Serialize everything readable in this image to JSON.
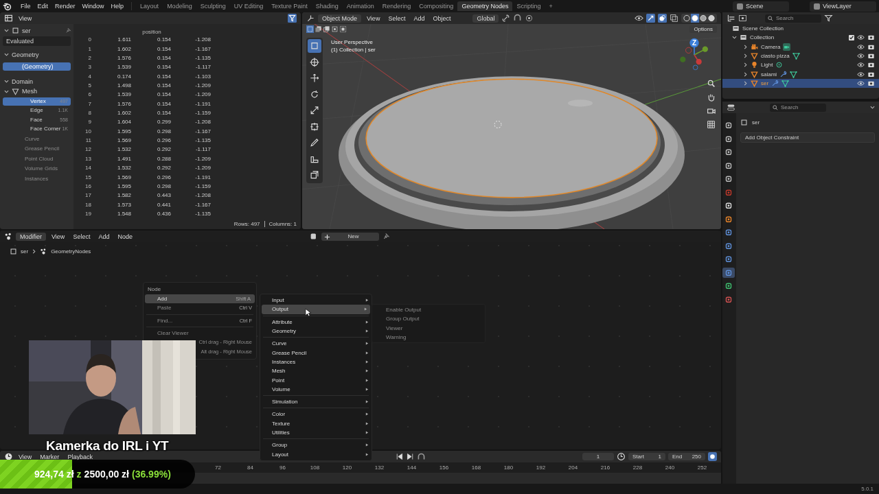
{
  "menu_bar": [
    "File",
    "Edit",
    "Render",
    "Window",
    "Help"
  ],
  "workspaces": [
    {
      "label": "Layout",
      "selected": false
    },
    {
      "label": "Modeling",
      "selected": false
    },
    {
      "label": "Sculpting",
      "selected": false
    },
    {
      "label": "UV Editing",
      "selected": false
    },
    {
      "label": "Texture Paint",
      "selected": false
    },
    {
      "label": "Shading",
      "selected": false
    },
    {
      "label": "Animation",
      "selected": false
    },
    {
      "label": "Rendering",
      "selected": false
    },
    {
      "label": "Compositing",
      "selected": false
    },
    {
      "label": "Geometry Nodes",
      "selected": true
    },
    {
      "label": "Scripting",
      "selected": false
    }
  ],
  "add_workspace": "+",
  "scene": "Scene",
  "view_layer": "ViewLayer",
  "spreadsheet": {
    "header_menu": "View",
    "object": "ser",
    "evaluation": "Evaluated",
    "geometry_label": "Geometry",
    "geometry_item": {
      "label": "(Geometry)",
      "selected": true
    },
    "domain_label": "Domain",
    "mesh_label": "Mesh",
    "domains": [
      {
        "label": "Vertex",
        "count": "497",
        "selected": true
      },
      {
        "label": "Edge",
        "count": "1.1K",
        "selected": false
      },
      {
        "label": "Face",
        "count": "558",
        "selected": false
      },
      {
        "label": "Face Corner",
        "count": "1K",
        "selected": false
      }
    ],
    "other_types": [
      {
        "label": "Curve",
        "disabled": true
      },
      {
        "label": "Grease Pencil",
        "disabled": true
      },
      {
        "label": "Point Cloud",
        "disabled": true
      },
      {
        "label": "Volume Grids",
        "disabled": true
      },
      {
        "label": "Instances",
        "disabled": true
      }
    ],
    "column_header": "position",
    "rows": [
      {
        "index": "0",
        "cells": [
          "1.611",
          "0.154",
          "-1.208"
        ]
      },
      {
        "index": "1",
        "cells": [
          "1.602",
          "0.154",
          "-1.167"
        ]
      },
      {
        "index": "2",
        "cells": [
          "1.576",
          "0.154",
          "-1.135"
        ]
      },
      {
        "index": "3",
        "cells": [
          "1.539",
          "0.154",
          "-1.117"
        ]
      },
      {
        "index": "4",
        "cells": [
          "0.174",
          "0.154",
          "-1.103"
        ]
      },
      {
        "index": "5",
        "cells": [
          "1.498",
          "0.154",
          "-1.209"
        ]
      },
      {
        "index": "6",
        "cells": [
          "1.539",
          "0.154",
          "-1.209"
        ]
      },
      {
        "index": "7",
        "cells": [
          "1.576",
          "0.154",
          "-1.191"
        ]
      },
      {
        "index": "8",
        "cells": [
          "1.602",
          "0.154",
          "-1.159"
        ]
      },
      {
        "index": "9",
        "cells": [
          "1.604",
          "0.299",
          "-1.208"
        ]
      },
      {
        "index": "10",
        "cells": [
          "1.595",
          "0.298",
          "-1.167"
        ]
      },
      {
        "index": "11",
        "cells": [
          "1.569",
          "0.296",
          "-1.135"
        ]
      },
      {
        "index": "12",
        "cells": [
          "1.532",
          "0.292",
          "-1.117"
        ]
      },
      {
        "index": "13",
        "cells": [
          "1.491",
          "0.288",
          "-1.209"
        ]
      },
      {
        "index": "14",
        "cells": [
          "1.532",
          "0.292",
          "-1.209"
        ]
      },
      {
        "index": "15",
        "cells": [
          "1.569",
          "0.296",
          "-1.191"
        ]
      },
      {
        "index": "16",
        "cells": [
          "1.595",
          "0.298",
          "-1.159"
        ]
      },
      {
        "index": "17",
        "cells": [
          "1.582",
          "0.443",
          "-1.208"
        ]
      },
      {
        "index": "18",
        "cells": [
          "1.573",
          "0.441",
          "-1.167"
        ]
      },
      {
        "index": "19",
        "cells": [
          "1.548",
          "0.436",
          "-1.135"
        ]
      }
    ],
    "rows_count": "Rows: 497",
    "columns_count": "Columns: 1"
  },
  "viewport": {
    "mode": "Object Mode",
    "menus": [
      "View",
      "Select",
      "Add",
      "Object"
    ],
    "orientation": "Global",
    "options": "Options",
    "overlay_lines": [
      "User Perspective",
      "(1) Collection | ser"
    ],
    "tools": [
      {
        "kind": "select",
        "selected": true
      },
      {
        "kind": "cursor",
        "selected": false
      },
      {
        "kind": "move",
        "selected": false
      },
      {
        "kind": "rotate",
        "selected": false
      },
      {
        "kind": "scale",
        "selected": false
      },
      {
        "kind": "transform",
        "selected": false
      },
      {
        "kind": "annotate",
        "selected": false
      },
      {
        "kind": "measure",
        "selected": false
      },
      {
        "kind": "add",
        "selected": false
      }
    ],
    "shading_modes": [
      {
        "kind": "wireframe",
        "selected": false
      },
      {
        "kind": "solid",
        "selected": true
      },
      {
        "kind": "material",
        "selected": false
      },
      {
        "kind": "rendered",
        "selected": false
      }
    ],
    "gizmo_axis": "Z"
  },
  "outliner": {
    "search_placeholder": "Search",
    "root": "Scene Collection",
    "collection": {
      "label": "Collection",
      "checked": true,
      "children": [
        {
          "label": "Camera",
          "kind": "camera",
          "has_modifier": false,
          "selected": false
        },
        {
          "label": "ciasto pizza",
          "kind": "mesh",
          "has_modifier": false,
          "selected": false
        },
        {
          "label": "Light",
          "kind": "light",
          "has_modifier": false,
          "selected": false
        },
        {
          "label": "salami",
          "kind": "mesh",
          "has_modifier": true,
          "selected": false
        },
        {
          "label": "ser",
          "kind": "mesh",
          "has_modifier": true,
          "selected": true
        }
      ]
    }
  },
  "properties": {
    "search_placeholder": "Search",
    "object": "ser",
    "constraint_button": "Add Object Constraint",
    "tabs": [
      {
        "kind": "tool",
        "selected": false
      },
      {
        "kind": "render",
        "selected": false
      },
      {
        "kind": "output",
        "selected": false
      },
      {
        "kind": "view_layer",
        "selected": false
      },
      {
        "kind": "scene",
        "selected": false
      },
      {
        "kind": "world",
        "selected": false
      },
      {
        "kind": "collection",
        "selected": false
      },
      {
        "kind": "object",
        "selected": false
      },
      {
        "kind": "modifier",
        "selected": false
      },
      {
        "kind": "particles",
        "selected": false
      },
      {
        "kind": "physics",
        "selected": false
      },
      {
        "kind": "constraint",
        "selected": true
      },
      {
        "kind": "data",
        "selected": false
      },
      {
        "kind": "material",
        "selected": false
      }
    ]
  },
  "node_editor": {
    "editor_type": "Modifier",
    "menus": [
      "View",
      "Select",
      "Add",
      "Node"
    ],
    "new_button": "New",
    "breadcrumb": [
      "ser",
      "GeometryNodes"
    ]
  },
  "context_menu": {
    "title": "Node",
    "items": [
      {
        "label": "Add",
        "shortcut": "Shift A",
        "disabled": false,
        "highlighted": true
      },
      {
        "label": "Paste",
        "shortcut": "Ctrl V",
        "disabled": true,
        "highlighted": false
      },
      {
        "label": "Find...",
        "shortcut": "Ctrl F",
        "disabled": true,
        "highlighted": false
      },
      {
        "label": "Clear Viewer",
        "disabled": true,
        "highlighted": false
      }
    ],
    "hints": [
      "Ctrl drag - Right Mouse",
      "Alt drag - Right Mouse"
    ]
  },
  "add_menu": {
    "groups": [
      [
        {
          "label": "Input",
          "selected": false
        },
        {
          "label": "Output",
          "selected": true
        }
      ],
      [
        {
          "label": "Attribute",
          "selected": false
        },
        {
          "label": "Geometry",
          "selected": false
        }
      ],
      [
        {
          "label": "Curve",
          "selected": false
        },
        {
          "label": "Grease Pencil",
          "selected": false
        },
        {
          "label": "Instances",
          "selected": false
        },
        {
          "label": "Mesh",
          "selected": false
        },
        {
          "label": "Point",
          "selected": false
        },
        {
          "label": "Volume",
          "selected": false
        }
      ],
      [
        {
          "label": "Simulation",
          "selected": false
        }
      ],
      [
        {
          "label": "Color",
          "selected": false
        },
        {
          "label": "Texture",
          "selected": false
        },
        {
          "label": "Utilities",
          "selected": false
        }
      ],
      [
        {
          "label": "Group",
          "selected": false
        },
        {
          "label": "Layout",
          "selected": false
        }
      ]
    ]
  },
  "output_submenu": [
    {
      "label": "Enable Output",
      "disabled": true
    },
    {
      "label": "Group Output",
      "disabled": true
    },
    {
      "label": "Viewer",
      "disabled": true
    },
    {
      "label": "Warning",
      "disabled": true
    }
  ],
  "timeline": {
    "menus": [
      "View",
      "Marker",
      "Playback"
    ],
    "current_frame": "1",
    "start_label": "Start",
    "start": "1",
    "end_label": "End",
    "end": "250",
    "ruler": [
      "72",
      "84",
      "96",
      "108",
      "120",
      "132",
      "144",
      "156",
      "168",
      "180",
      "192",
      "204",
      "216",
      "228",
      "240",
      "252"
    ]
  },
  "status_bar": {
    "version": "5.0.1"
  },
  "stream_overlay": {
    "caption": "Kamerka do IRL i YT",
    "raised": "924,74 zł",
    "separator": "z",
    "goal": "2500,00 zł",
    "percent": "(36.99%)",
    "level": 0.3699
  }
}
